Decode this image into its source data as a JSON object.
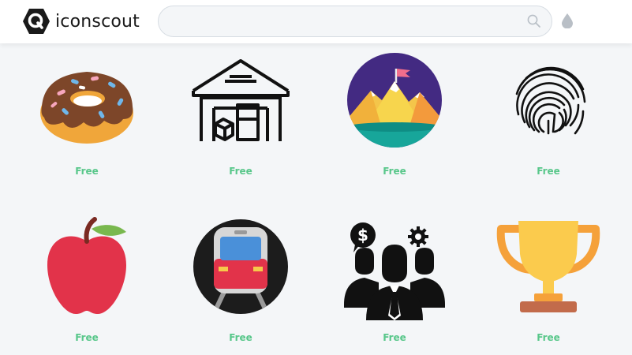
{
  "brand": {
    "name": "iconscout"
  },
  "search": {
    "value": "",
    "placeholder": ""
  },
  "icons": [
    {
      "name": "donut",
      "price": "Free"
    },
    {
      "name": "warehouse",
      "price": "Free"
    },
    {
      "name": "mountain-flag",
      "price": "Free"
    },
    {
      "name": "fingerprint",
      "price": "Free"
    },
    {
      "name": "apple",
      "price": "Free"
    },
    {
      "name": "train",
      "price": "Free"
    },
    {
      "name": "business-team",
      "price": "Free"
    },
    {
      "name": "trophy",
      "price": "Free"
    }
  ],
  "colors": {
    "accent": "#58c78a",
    "brand_dark": "#1a1a1a"
  }
}
